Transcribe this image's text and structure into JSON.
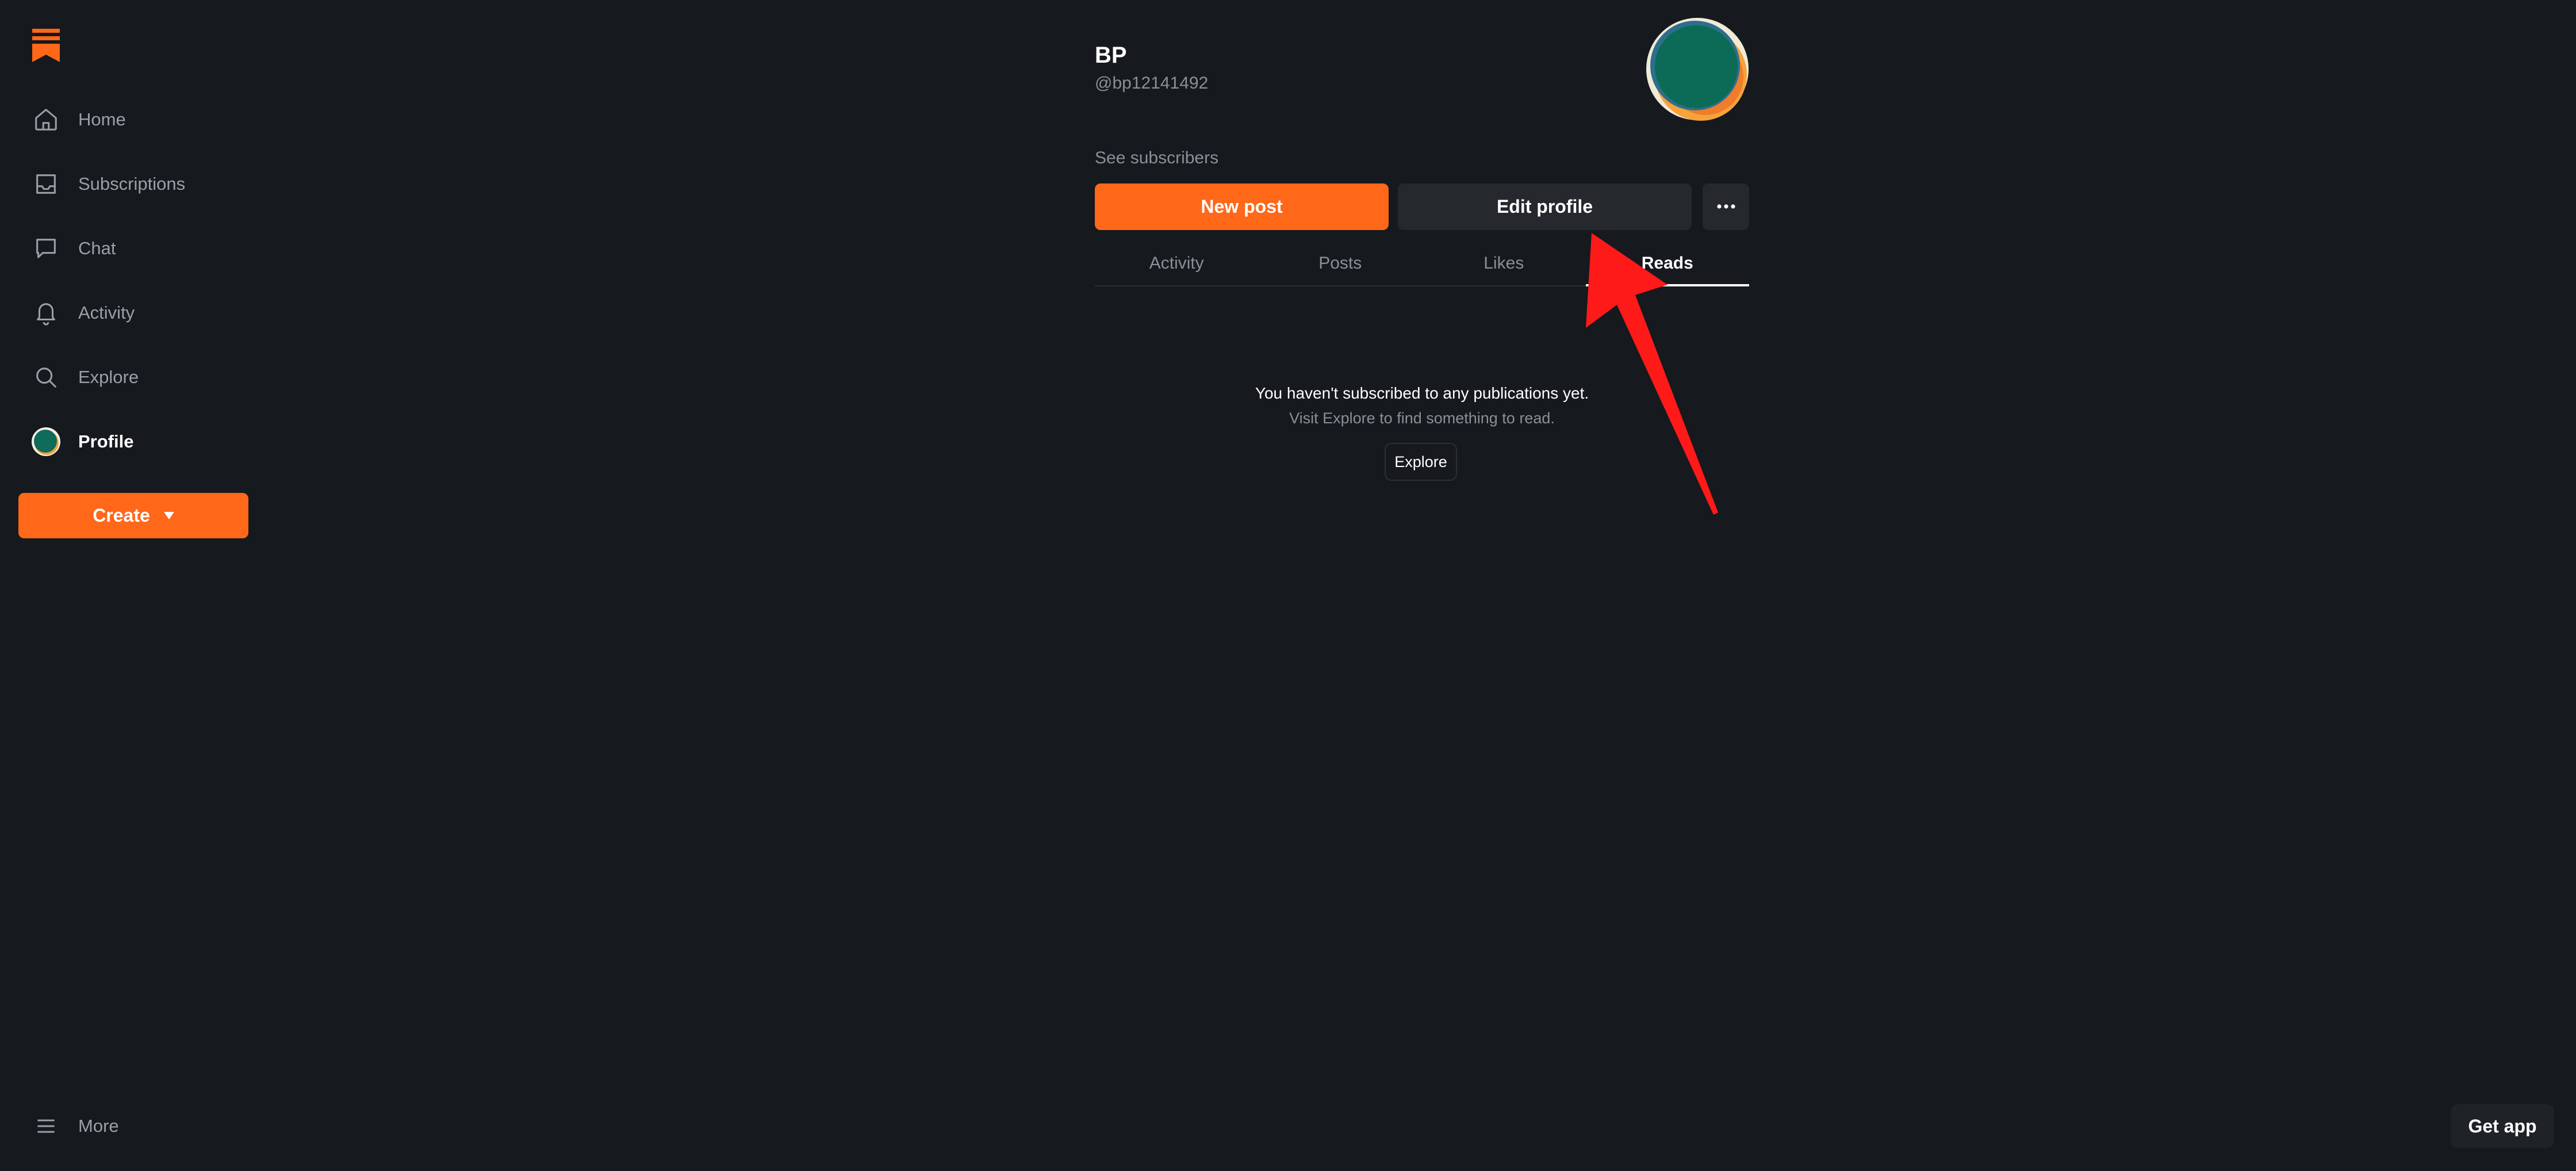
{
  "sidebar": {
    "logo_icon": "substack-logo-icon",
    "items": [
      {
        "label": "Home",
        "icon": "home-icon"
      },
      {
        "label": "Subscriptions",
        "icon": "inbox-icon"
      },
      {
        "label": "Chat",
        "icon": "chat-bubble-icon"
      },
      {
        "label": "Activity",
        "icon": "bell-icon"
      },
      {
        "label": "Explore",
        "icon": "search-icon"
      },
      {
        "label": "Profile",
        "icon": "avatar-icon",
        "active": true
      }
    ],
    "create_label": "Create",
    "more_label": "More"
  },
  "profile": {
    "name": "BP",
    "handle": "@bp12141492",
    "see_subscribers": "See subscribers",
    "new_post_label": "New post",
    "edit_profile_label": "Edit profile",
    "more_icon": "ellipsis-icon"
  },
  "tabs": [
    {
      "label": "Activity"
    },
    {
      "label": "Posts"
    },
    {
      "label": "Likes"
    },
    {
      "label": "Reads",
      "active": true
    }
  ],
  "empty_state": {
    "title": "You haven't subscribed to any publications yet.",
    "subtitle": "Visit Explore to find something to read.",
    "button_label": "Explore"
  },
  "get_app_label": "Get app",
  "colors": {
    "background": "#16191d",
    "accent": "#ff6719",
    "secondary_button": "#25282c",
    "annotation_arrow": "#ff1a1a"
  }
}
